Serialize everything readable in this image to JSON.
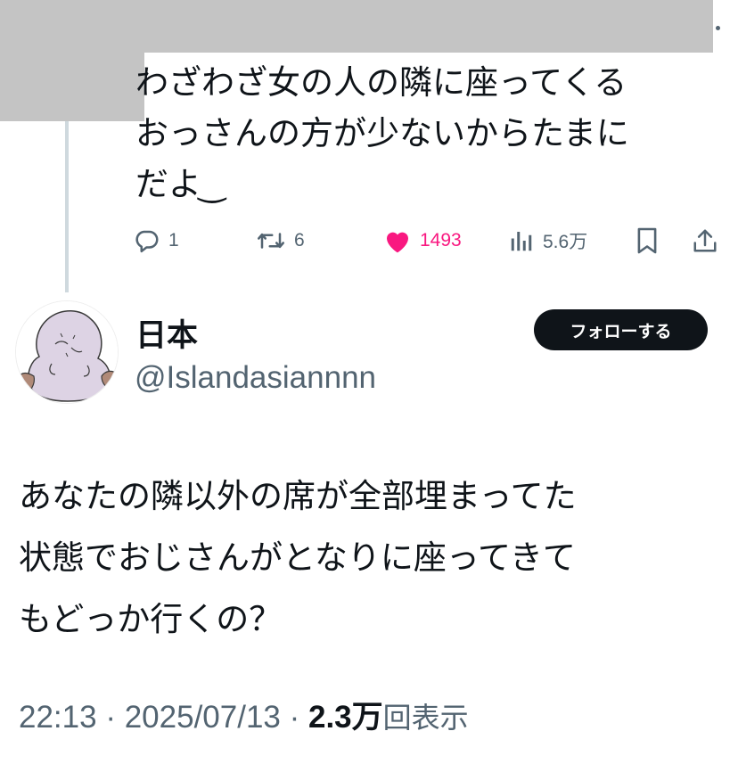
{
  "reply": {
    "text": "わざわざ女の人の隣に座ってくる\nおっさんの方が少ないからたまに\nだよ ͜",
    "reply_count": "1",
    "retweet_count": "6",
    "like_count": "1493",
    "view_count": "5.6万"
  },
  "author": {
    "display_name": "日本",
    "handle": "@Islandasiannnn",
    "follow_label": "フォローする"
  },
  "tweet": {
    "text": "あなたの隣以外の席が全部埋まってた\n状態でおじさんがとなりに座ってきて\nもどっか行くの？",
    "time": "22:13",
    "date": "2025/07/13",
    "separator": " · ",
    "views_number": "2.3万",
    "views_label": "回表示"
  },
  "colors": {
    "like": "#f91880",
    "secondary_text": "#536471",
    "primary_text": "#0f1419",
    "follow_bg": "#0f1419",
    "redaction": "#c4c4c4"
  },
  "icons": [
    "reply-icon",
    "retweet-icon",
    "heart-icon",
    "views-icon",
    "bookmark-icon",
    "share-icon"
  ]
}
